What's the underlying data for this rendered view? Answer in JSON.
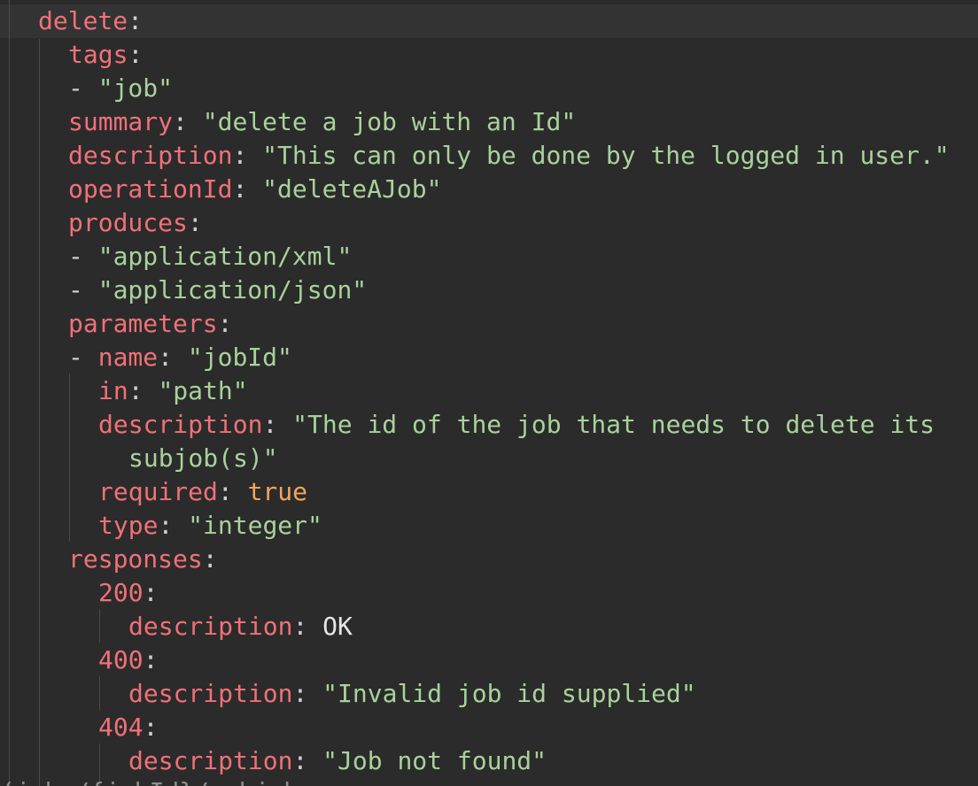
{
  "code": {
    "top_partial": ":",
    "bottom_partial": "(jobs/{jobId}/subjobs",
    "delete_key": "delete",
    "tags_key": "tags",
    "tag_job": "\"job\"",
    "summary_key": "summary",
    "summary_value": "\"delete a job with an Id\"",
    "description_key": "description",
    "description_value": "\"This can only be done by the logged in user.\"",
    "operationId_key": "operationId",
    "operationId_value": "\"deleteAJob\"",
    "produces_key": "produces",
    "produces_xml": "\"application/xml\"",
    "produces_json": "\"application/json\"",
    "parameters_key": "parameters",
    "name_key": "name",
    "name_value": "\"jobId\"",
    "in_key": "in",
    "in_value": "\"path\"",
    "param_description_value_1": "\"The id of the job that needs to delete its",
    "param_description_value_2": "subjob(s)\"",
    "required_key": "required",
    "required_value": "true",
    "type_key": "type",
    "type_value": "\"integer\"",
    "responses_key": "responses",
    "code_200": "200",
    "desc_200": "OK",
    "code_400": "400",
    "desc_400": "\"Invalid job id supplied\"",
    "code_404": "404",
    "desc_404": "\"Job not found\""
  },
  "colors": {
    "background": "#2b2b2b",
    "key": "#f07178",
    "string": "#a8d29b",
    "boolean": "#f3a55a"
  }
}
